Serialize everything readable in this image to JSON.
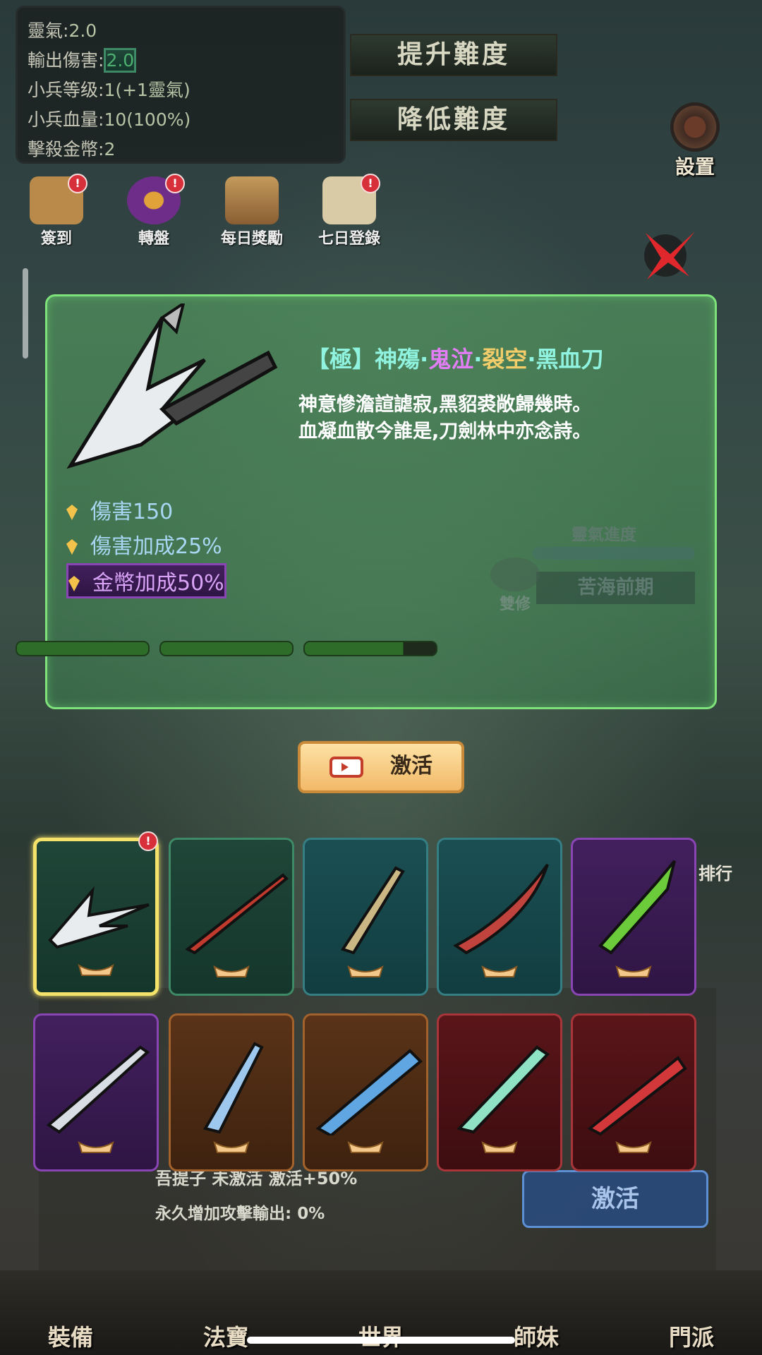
{
  "stats": [
    {
      "label": "靈氣:",
      "value": "2.0",
      "accent": false
    },
    {
      "label": "輸出傷害:",
      "value": "2.0",
      "accent": true
    },
    {
      "label": "小兵等级:",
      "value": "1(+1靈氣)",
      "accent": false
    },
    {
      "label": "小兵血量:",
      "value": "10(100%)",
      "accent": false
    },
    {
      "label": "擊殺金幣:",
      "value": "2",
      "accent": false
    }
  ],
  "difficulty": {
    "raise": "提升難度",
    "lower": "降低難度"
  },
  "settings_label": "設置",
  "quick_menu": [
    {
      "label": "簽到",
      "icon": "sign-in-icon",
      "badge": "!"
    },
    {
      "label": "轉盤",
      "icon": "wheel-icon",
      "badge": "!"
    },
    {
      "label": "每日獎勵",
      "icon": "chest-icon",
      "badge": ""
    },
    {
      "label": "七日登錄",
      "icon": "scroll-icon",
      "badge": "!"
    }
  ],
  "weapon": {
    "title_prefix": "【極】神殤·",
    "title_purple": "鬼泣",
    "title_dot": "·",
    "title_gold": "裂空",
    "title_suffix": "·黑血刀",
    "poem_line1": "神意慘澹諠謔寂,黑貂裘敞歸幾時。",
    "poem_line2": "血凝血散今誰是,刀劍林中亦念詩。",
    "attributes": [
      {
        "text": "傷害150",
        "color": "blue"
      },
      {
        "text": "傷害加成25%",
        "color": "blue"
      },
      {
        "text": "金幣加成50%",
        "color": "purple"
      }
    ]
  },
  "background": {
    "progress_title": "靈氣進度",
    "stage": "苦海前期",
    "twin_label": "雙修",
    "rank_label": "排行",
    "activate_bg": "激活",
    "bottom_row_text": "吾提子 未激活 激活+50%",
    "bottom_row_text2": "永久增加攻擊輸出: 0%",
    "enemy_hp": [
      1.0,
      1.0,
      0.75
    ]
  },
  "activate_button": {
    "label": "激活",
    "icon": "video-icon"
  },
  "weapons_grid": [
    {
      "name": "weapon-card-1",
      "rarity": "green",
      "selected": true,
      "badge": "!"
    },
    {
      "name": "weapon-card-2",
      "rarity": "green",
      "selected": false
    },
    {
      "name": "weapon-card-3",
      "rarity": "teal",
      "selected": false
    },
    {
      "name": "weapon-card-4",
      "rarity": "teal",
      "selected": false
    },
    {
      "name": "weapon-card-5",
      "rarity": "purple",
      "selected": false
    },
    {
      "name": "weapon-card-6",
      "rarity": "purple",
      "selected": false
    },
    {
      "name": "weapon-card-7",
      "rarity": "brown",
      "selected": false
    },
    {
      "name": "weapon-card-8",
      "rarity": "brown",
      "selected": false
    },
    {
      "name": "weapon-card-9",
      "rarity": "red",
      "selected": false
    },
    {
      "name": "weapon-card-10",
      "rarity": "red",
      "selected": false
    }
  ],
  "bottom_nav": [
    {
      "label": "裝備"
    },
    {
      "label": "法寶"
    },
    {
      "label": "世界"
    },
    {
      "label": "師妹"
    },
    {
      "label": "門派"
    }
  ]
}
